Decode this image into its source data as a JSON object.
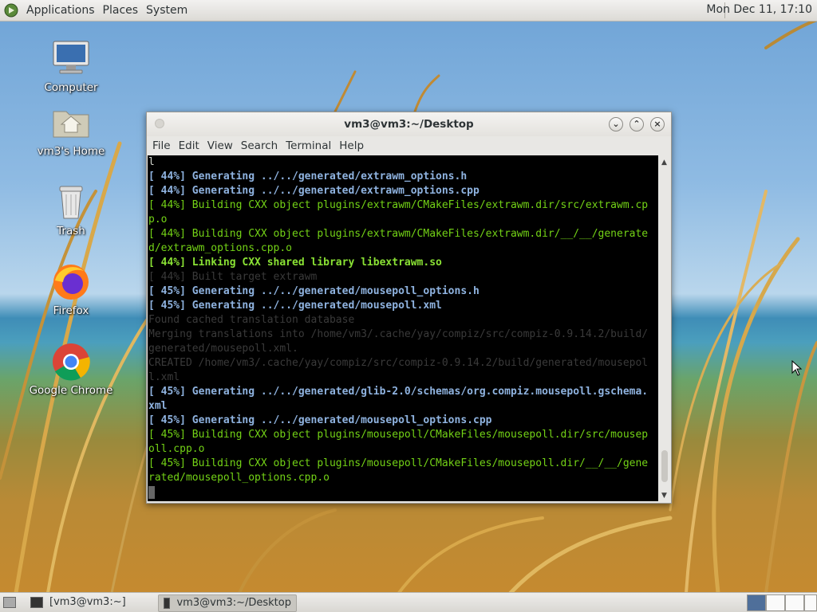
{
  "top_panel": {
    "menus": [
      "Applications",
      "Places",
      "System"
    ],
    "clock": "Mon Dec 11, 17:10"
  },
  "desktop_icons": [
    {
      "label": "Computer",
      "icon": "computer-icon"
    },
    {
      "label": "vm3's Home",
      "icon": "home-folder-icon"
    },
    {
      "label": "Trash",
      "icon": "trash-icon"
    },
    {
      "label": "Firefox",
      "icon": "firefox-icon"
    },
    {
      "label": "Google Chrome",
      "icon": "chrome-icon"
    }
  ],
  "window": {
    "title": "vm3@vm3:~/Desktop",
    "menus": [
      "File",
      "Edit",
      "View",
      "Search",
      "Terminal",
      "Help"
    ],
    "lines": [
      "l",
      "[ 44%] Generating ../../generated/extrawm_options.h",
      "[ 44%] Generating ../../generated/extrawm_options.cpp",
      "[ 44%] Building CXX object plugins/extrawm/CMakeFiles/extrawm.dir/src/extrawm.cp",
      "p.o",
      "[ 44%] Building CXX object plugins/extrawm/CMakeFiles/extrawm.dir/__/__/generate",
      "d/extrawm_options.cpp.o",
      "[ 44%] Linking CXX shared library libextrawm.so",
      "[ 44%] Built target extrawm",
      "[ 45%] Generating ../../generated/mousepoll_options.h",
      "[ 45%] Generating ../../generated/mousepoll.xml",
      "Found cached translation database",
      "Merging translations into /home/vm3/.cache/yay/compiz/src/compiz-0.9.14.2/build/",
      "generated/mousepoll.xml.",
      "CREATED /home/vm3/.cache/yay/compiz/src/compiz-0.9.14.2/build/generated/mousepol",
      "l.xml",
      "[ 45%] Generating ../../generated/glib-2.0/schemas/org.compiz.mousepoll.gschema.",
      "xml",
      "[ 45%] Generating ../../generated/mousepoll_options.cpp",
      "[ 45%] Building CXX object plugins/mousepoll/CMakeFiles/mousepoll.dir/src/mousep",
      "oll.cpp.o",
      "[ 45%] Building CXX object plugins/mousepoll/CMakeFiles/mousepoll.dir/__/__/gene",
      "rated/mousepoll_options.cpp.o"
    ]
  },
  "taskbar": {
    "tasks": [
      "[vm3@vm3:~]",
      "vm3@vm3:~/Desktop"
    ]
  }
}
